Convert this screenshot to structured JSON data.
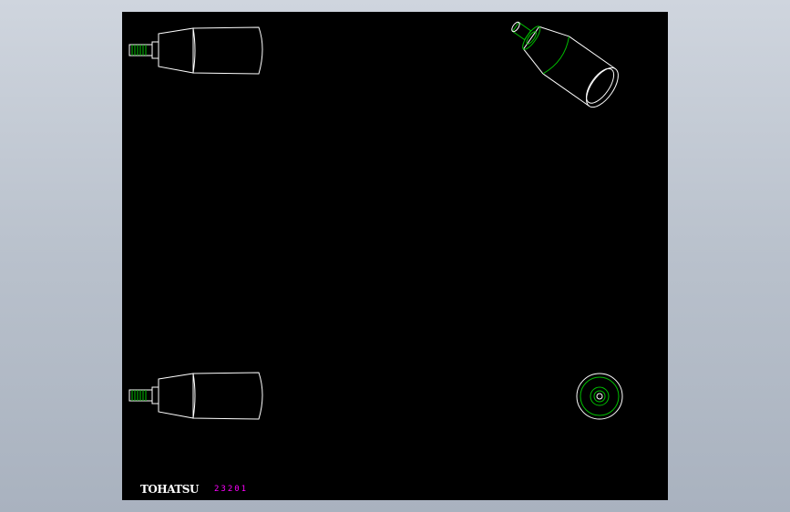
{
  "drawing": {
    "brand_logo": "TOHATSU",
    "part_number": "23201"
  },
  "colors": {
    "background": "#b9c1cc",
    "sheet": "#000000",
    "outline": "#ffffff",
    "hidden_detail": "#00c000",
    "part_number": "#ff00ff"
  }
}
